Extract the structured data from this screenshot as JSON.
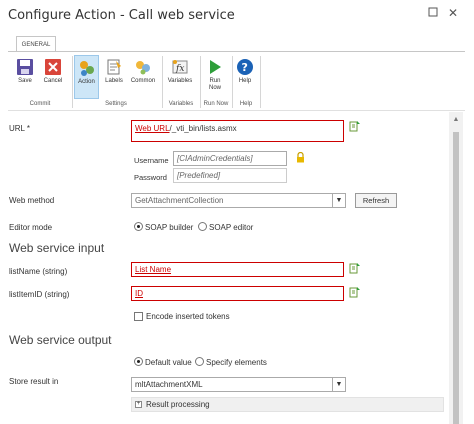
{
  "window": {
    "title": "Configure Action - Call web service"
  },
  "ribbon": {
    "tab": "GENERAL",
    "buttons": {
      "save": "Save",
      "cancel": "Cancel",
      "action": "Action",
      "labels": "Labels",
      "common": "Common",
      "variables": "Variables",
      "run_now_line1": "Run",
      "run_now_line2": "Now",
      "help": "Help"
    },
    "groups": {
      "commit": "Commit",
      "settings": "Settings",
      "variables": "Variables",
      "run_now": "Run Now",
      "help": "Help"
    }
  },
  "form": {
    "url": {
      "label": "URL *",
      "token": "Web URL",
      "rest": "/_vti_bin/lists.asmx"
    },
    "username": {
      "label": "Username",
      "value": "[CIAdminCredentials]"
    },
    "password": {
      "label": "Password",
      "value": "[Predefined]"
    },
    "web_method": {
      "label": "Web method",
      "value": "GetAttachmentCollection",
      "refresh": "Refresh"
    },
    "editor_mode": {
      "label": "Editor mode",
      "options": [
        "SOAP builder",
        "SOAP editor"
      ],
      "selected": "SOAP builder"
    },
    "input_section": "Web service input",
    "list_name": {
      "label": "listName (string)",
      "value": "List Name"
    },
    "list_item_id": {
      "label": "listItemID (string)",
      "value": "ID"
    },
    "encode_tokens": {
      "label": "Encode inserted tokens",
      "checked": false
    },
    "output_section": "Web service output",
    "output_mode": {
      "options": [
        "Default value",
        "Specify elements"
      ],
      "selected": "Default value"
    },
    "store_result": {
      "label": "Store result in",
      "value": "mltAttachmentXML"
    },
    "result_processing": "Result processing"
  },
  "colors": {
    "token_red": "#cc0000",
    "active_button_bg": "#cde6f7",
    "save_icon": "#5a4ea0",
    "cancel_icon": "#d9453a",
    "run_icon": "#2e9e3a",
    "help_icon": "#1b62b6"
  }
}
